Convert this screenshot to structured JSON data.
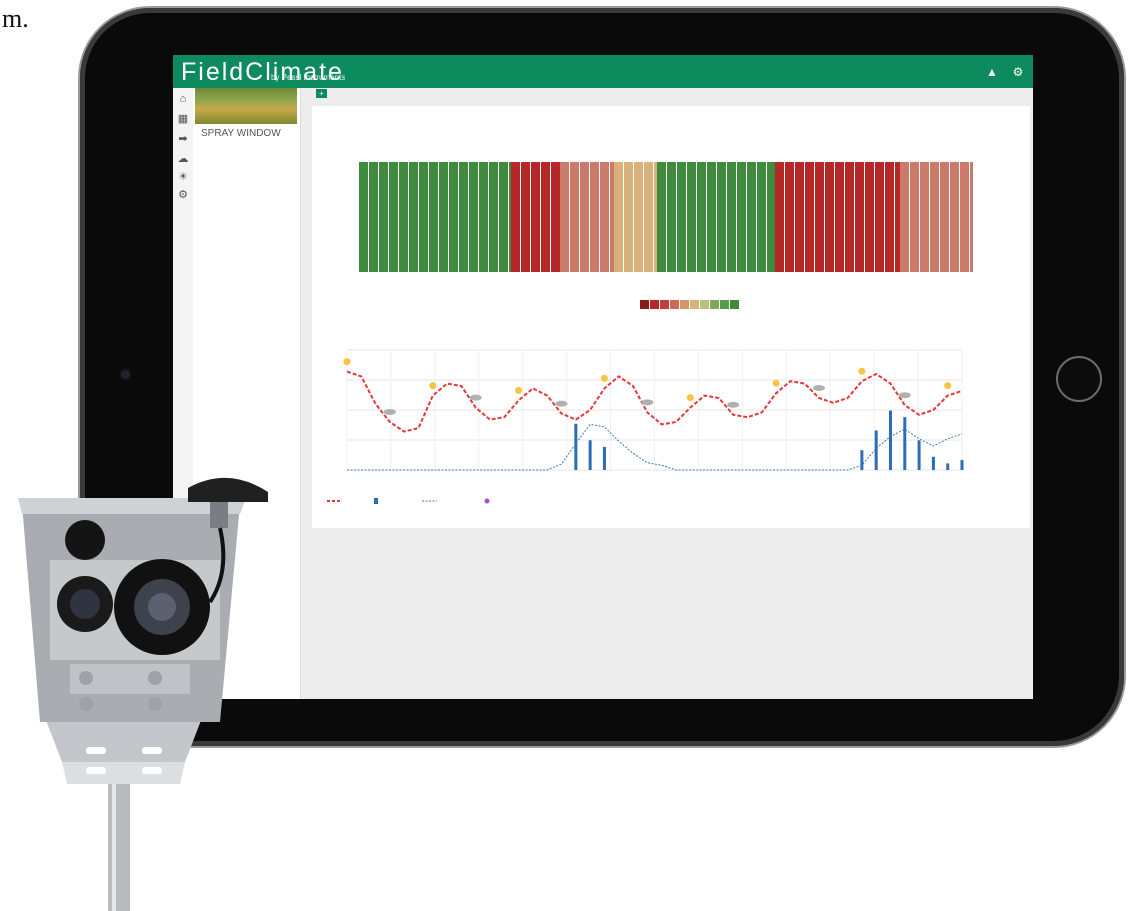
{
  "page_fragment": "m.",
  "app": {
    "logo_text": "FieldClimate",
    "logo_sub": "by Pessl Instruments"
  },
  "header": {
    "icons": [
      "user-icon",
      "settings-icon"
    ],
    "icon_glyphs": [
      "▲",
      "⚙"
    ]
  },
  "rail": {
    "icons": [
      "home-icon",
      "grid-icon",
      "send-icon",
      "cloud-icon",
      "sun-icon",
      "gear-icon"
    ],
    "glyphs": [
      "⌂",
      "▦",
      "➡",
      "☁",
      "☀",
      "⚙"
    ]
  },
  "sidebar": {
    "item_label": "SPRAY WINDOW"
  },
  "toolbar": {
    "add_label": "+"
  },
  "colors": {
    "brand": "#0e8a5f",
    "good": "#3f8a3c",
    "bad": "#b42828",
    "poor": "#cc7a6a",
    "fair": "#d8b27a",
    "temperature_line": "#e23a3a",
    "humidity_line": "#3a7ac0",
    "precipitation_bars": "#2a6fb5"
  },
  "spray_window": {
    "segments": [
      {
        "status": "good",
        "color": "#3f8a3c",
        "share": 0.25
      },
      {
        "status": "bad",
        "color": "#b42828",
        "share": 0.08
      },
      {
        "status": "poor",
        "color": "#cc7a6a",
        "share": 0.09
      },
      {
        "status": "fair",
        "color": "#d8b27a",
        "share": 0.07
      },
      {
        "status": "good",
        "color": "#3f8a3c",
        "share": 0.195
      },
      {
        "status": "bad",
        "color": "#b42828",
        "share": 0.205
      },
      {
        "status": "poor",
        "color": "#cc7a6a",
        "share": 0.12
      }
    ],
    "tick_labels": [
      "",
      "",
      "",
      "",
      "",
      "",
      "",
      "",
      "",
      "",
      "",
      "",
      "",
      ""
    ],
    "legend_colors": [
      "#8a1a1a",
      "#b42828",
      "#c04040",
      "#cc6a5a",
      "#d8956a",
      "#d8b27a",
      "#b8c07a",
      "#7ea85a",
      "#5a9a48",
      "#3f8a3c"
    ]
  },
  "chart_data": {
    "type": "line",
    "title": "",
    "xlabel": "",
    "ylabel": "",
    "series": [
      {
        "values": [
          0.82,
          0.78,
          0.55,
          0.4,
          0.32,
          0.35,
          0.62,
          0.72,
          0.7,
          0.52,
          0.42,
          0.44,
          0.58,
          0.68,
          0.62,
          0.47,
          0.42,
          0.5,
          0.68,
          0.78,
          0.7,
          0.48,
          0.38,
          0.4,
          0.52,
          0.62,
          0.6,
          0.46,
          0.44,
          0.48,
          0.64,
          0.74,
          0.72,
          0.6,
          0.56,
          0.6,
          0.74,
          0.8,
          0.72,
          0.54,
          0.46,
          0.5,
          0.62,
          0.66
        ]
      },
      {
        "values": [
          0,
          0,
          0,
          0,
          0,
          0,
          0,
          0,
          0,
          0,
          0,
          0,
          0,
          0,
          0,
          0.05,
          0.22,
          0.38,
          0.36,
          0.24,
          0.14,
          0.06,
          0.04,
          0,
          0,
          0,
          0,
          0,
          0,
          0,
          0,
          0,
          0,
          0,
          0,
          0,
          0.04,
          0.18,
          0.28,
          0.34,
          0.26,
          0.2,
          0.26,
          0.3
        ]
      },
      {
        "values": [
          0,
          0,
          0,
          0,
          0,
          0,
          0,
          0,
          0,
          0,
          0,
          0,
          0,
          0,
          0,
          0,
          0.7,
          0.45,
          0.35,
          0,
          0,
          0,
          0,
          0,
          0,
          0,
          0,
          0,
          0,
          0,
          0,
          0,
          0,
          0,
          0,
          0,
          0.3,
          0.6,
          0.9,
          0.8,
          0.45,
          0.2,
          0.1,
          0.15
        ]
      }
    ],
    "legend": [],
    "grid": true
  }
}
